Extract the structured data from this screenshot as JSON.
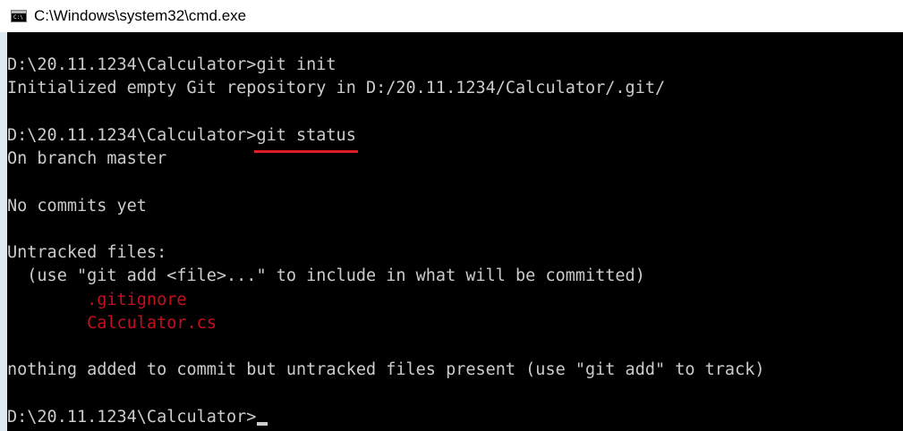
{
  "window": {
    "title": "C:\\Windows\\system32\\cmd.exe",
    "icon": "cmd-icon"
  },
  "console": {
    "lines": [
      {
        "prompt": "D:\\20.11.1234\\Calculator>",
        "command": "git init"
      },
      {
        "text": "Initialized empty Git repository in D:/20.11.1234/Calculator/.git/"
      },
      {
        "text": ""
      },
      {
        "prompt": "D:\\20.11.1234\\Calculator>",
        "command": "git status"
      },
      {
        "text": "On branch master"
      },
      {
        "text": ""
      },
      {
        "text": "No commits yet"
      },
      {
        "text": ""
      },
      {
        "text": "Untracked files:"
      },
      {
        "text": "  (use \"git add <file>...\" to include in what will be committed)"
      },
      {
        "text": "        .gitignore"
      },
      {
        "text": "        Calculator.cs"
      },
      {
        "text": ""
      },
      {
        "text": "nothing added to commit but untracked files present (use \"git add\" to track)"
      },
      {
        "text": ""
      },
      {
        "prompt": "D:\\20.11.1234\\Calculator>"
      }
    ]
  },
  "colors": {
    "background": "#000000",
    "foreground": "#cccccc",
    "untracked": "#c50f1f",
    "highlight_underline": "#e01b24"
  }
}
